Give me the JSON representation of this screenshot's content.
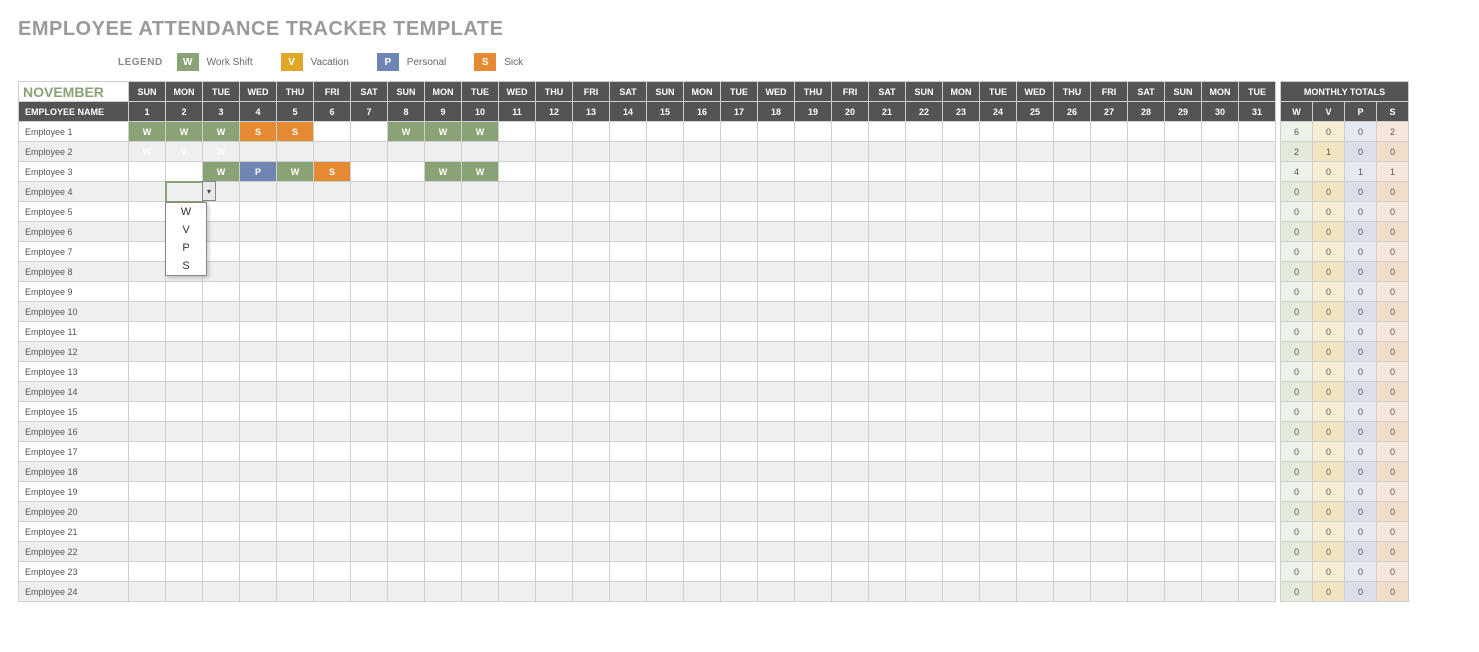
{
  "title": "EMPLOYEE ATTENDANCE TRACKER TEMPLATE",
  "legend": {
    "label": "LEGEND",
    "items": [
      {
        "code": "W",
        "text": "Work Shift",
        "class": "c-w"
      },
      {
        "code": "V",
        "text": "Vacation",
        "class": "c-v"
      },
      {
        "code": "P",
        "text": "Personal",
        "class": "c-p"
      },
      {
        "code": "S",
        "text": "Sick",
        "class": "c-s"
      }
    ]
  },
  "month": "NOVEMBER",
  "emp_header": "EMPLOYEE NAME",
  "day_headers": [
    "SUN",
    "MON",
    "TUE",
    "WED",
    "THU",
    "FRI",
    "SAT",
    "SUN",
    "MON",
    "TUE",
    "WED",
    "THU",
    "FRI",
    "SAT",
    "SUN",
    "MON",
    "TUE",
    "WED",
    "THU",
    "FRI",
    "SAT",
    "SUN",
    "MON",
    "TUE",
    "WED",
    "THU",
    "FRI",
    "SAT",
    "SUN",
    "MON",
    "TUE"
  ],
  "day_numbers": [
    "1",
    "2",
    "3",
    "4",
    "5",
    "6",
    "7",
    "8",
    "9",
    "10",
    "11",
    "12",
    "13",
    "14",
    "15",
    "16",
    "17",
    "18",
    "19",
    "20",
    "21",
    "22",
    "23",
    "24",
    "25",
    "26",
    "27",
    "28",
    "29",
    "30",
    "31"
  ],
  "totals_header": "MONTHLY TOTALS",
  "totals_cols": [
    "W",
    "V",
    "P",
    "S"
  ],
  "dropdown_options": [
    "W",
    "V",
    "P",
    "S"
  ],
  "selected": {
    "row": 3,
    "col": 1
  },
  "employees": [
    {
      "name": "Employee 1",
      "days": {
        "0": "W",
        "1": "W",
        "2": "W",
        "3": "S",
        "4": "S",
        "7": "W",
        "8": "W",
        "9": "W"
      },
      "totals": {
        "W": "6",
        "V": "0",
        "P": "0",
        "S": "2"
      }
    },
    {
      "name": "Employee 2",
      "days": {
        "0": "W",
        "1": "V",
        "2": "W"
      },
      "totals": {
        "W": "2",
        "V": "1",
        "P": "0",
        "S": "0"
      }
    },
    {
      "name": "Employee 3",
      "days": {
        "2": "W",
        "3": "P",
        "4": "W",
        "5": "S",
        "8": "W",
        "9": "W"
      },
      "totals": {
        "W": "4",
        "V": "0",
        "P": "1",
        "S": "1"
      }
    },
    {
      "name": "Employee 4",
      "days": {},
      "totals": {
        "W": "0",
        "V": "0",
        "P": "0",
        "S": "0"
      }
    },
    {
      "name": "Employee 5",
      "days": {},
      "totals": {
        "W": "0",
        "V": "0",
        "P": "0",
        "S": "0"
      }
    },
    {
      "name": "Employee 6",
      "days": {},
      "totals": {
        "W": "0",
        "V": "0",
        "P": "0",
        "S": "0"
      }
    },
    {
      "name": "Employee 7",
      "days": {},
      "totals": {
        "W": "0",
        "V": "0",
        "P": "0",
        "S": "0"
      }
    },
    {
      "name": "Employee 8",
      "days": {},
      "totals": {
        "W": "0",
        "V": "0",
        "P": "0",
        "S": "0"
      }
    },
    {
      "name": "Employee 9",
      "days": {},
      "totals": {
        "W": "0",
        "V": "0",
        "P": "0",
        "S": "0"
      }
    },
    {
      "name": "Employee 10",
      "days": {},
      "totals": {
        "W": "0",
        "V": "0",
        "P": "0",
        "S": "0"
      }
    },
    {
      "name": "Employee 11",
      "days": {},
      "totals": {
        "W": "0",
        "V": "0",
        "P": "0",
        "S": "0"
      }
    },
    {
      "name": "Employee 12",
      "days": {},
      "totals": {
        "W": "0",
        "V": "0",
        "P": "0",
        "S": "0"
      }
    },
    {
      "name": "Employee 13",
      "days": {},
      "totals": {
        "W": "0",
        "V": "0",
        "P": "0",
        "S": "0"
      }
    },
    {
      "name": "Employee 14",
      "days": {},
      "totals": {
        "W": "0",
        "V": "0",
        "P": "0",
        "S": "0"
      }
    },
    {
      "name": "Employee 15",
      "days": {},
      "totals": {
        "W": "0",
        "V": "0",
        "P": "0",
        "S": "0"
      }
    },
    {
      "name": "Employee 16",
      "days": {},
      "totals": {
        "W": "0",
        "V": "0",
        "P": "0",
        "S": "0"
      }
    },
    {
      "name": "Employee 17",
      "days": {},
      "totals": {
        "W": "0",
        "V": "0",
        "P": "0",
        "S": "0"
      }
    },
    {
      "name": "Employee 18",
      "days": {},
      "totals": {
        "W": "0",
        "V": "0",
        "P": "0",
        "S": "0"
      }
    },
    {
      "name": "Employee 19",
      "days": {},
      "totals": {
        "W": "0",
        "V": "0",
        "P": "0",
        "S": "0"
      }
    },
    {
      "name": "Employee 20",
      "days": {},
      "totals": {
        "W": "0",
        "V": "0",
        "P": "0",
        "S": "0"
      }
    },
    {
      "name": "Employee 21",
      "days": {},
      "totals": {
        "W": "0",
        "V": "0",
        "P": "0",
        "S": "0"
      }
    },
    {
      "name": "Employee 22",
      "days": {},
      "totals": {
        "W": "0",
        "V": "0",
        "P": "0",
        "S": "0"
      }
    },
    {
      "name": "Employee 23",
      "days": {},
      "totals": {
        "W": "0",
        "V": "0",
        "P": "0",
        "S": "0"
      }
    },
    {
      "name": "Employee 24",
      "days": {},
      "totals": {
        "W": "0",
        "V": "0",
        "P": "0",
        "S": "0"
      }
    }
  ]
}
